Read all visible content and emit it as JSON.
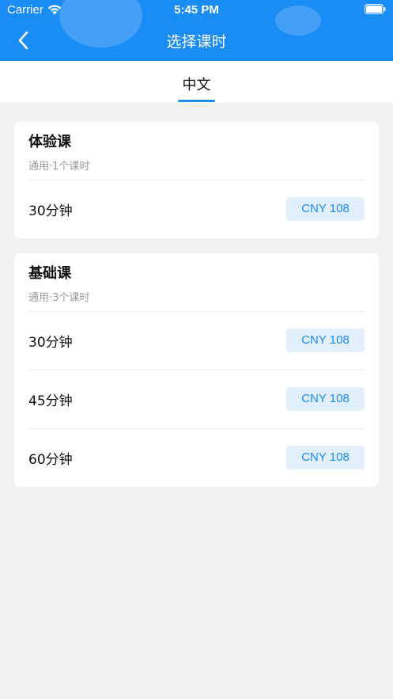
{
  "status_bar": {
    "carrier": "Carrier",
    "time": "5:45 PM"
  },
  "nav": {
    "title": "选择课时"
  },
  "tabs": [
    {
      "label": "中文"
    }
  ],
  "courses": [
    {
      "title": "体验课",
      "subtitle": "通用·1个课时",
      "options": [
        {
          "duration": "30分钟",
          "price": "CNY 108"
        }
      ]
    },
    {
      "title": "基础课",
      "subtitle": "通用·3个课时",
      "options": [
        {
          "duration": "30分钟",
          "price": "CNY 108"
        },
        {
          "duration": "45分钟",
          "price": "CNY 108"
        },
        {
          "duration": "60分钟",
          "price": "CNY 108"
        }
      ]
    }
  ],
  "colors": {
    "accent": "#1a8cf5",
    "price_bg": "#e2effd",
    "page_bg": "#f2f2f2"
  },
  "icons": {
    "back": "chevron-left-icon",
    "wifi": "wifi-icon",
    "battery": "battery-icon"
  }
}
